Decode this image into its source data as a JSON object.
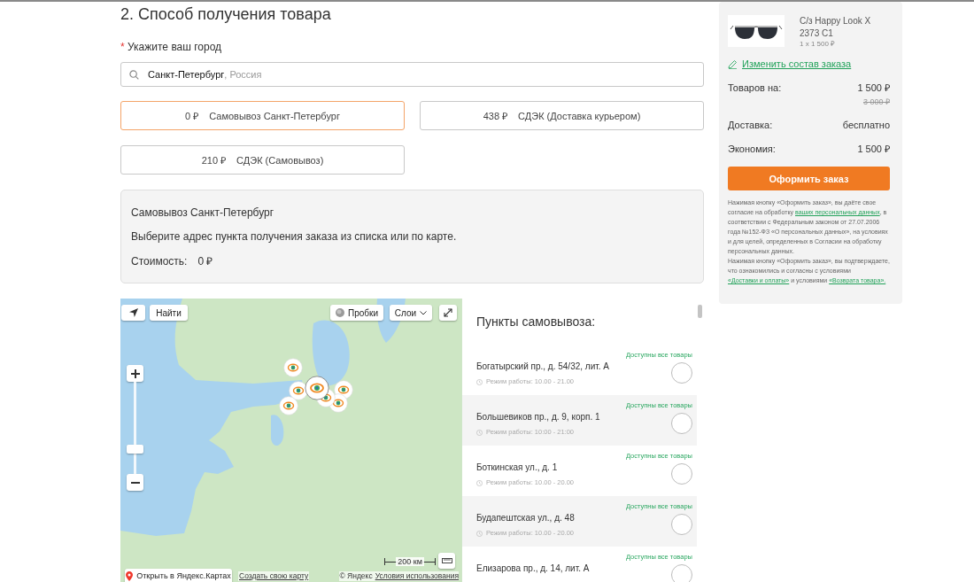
{
  "section": {
    "title": "2. Способ получения товара"
  },
  "city": {
    "required_mark": "*",
    "label": "Укажите ваш город",
    "value": "Санкт-Петербург",
    "suffix": ", Россия"
  },
  "delivery_options": [
    {
      "price": "0 ₽",
      "label": "Самовывоз Санкт-Петербург",
      "selected": true
    },
    {
      "price": "438 ₽",
      "label": "СДЭК (Доставка курьером)",
      "selected": false
    },
    {
      "price": "210 ₽",
      "label": "СДЭК (Самовывоз)",
      "selected": false
    }
  ],
  "info_panel": {
    "title": "Самовывоз Санкт-Петербург",
    "instruction": "Выберите адрес пункта получения заказа из списка или по карте.",
    "cost_label": "Стоимость:",
    "cost_value": "0 ₽"
  },
  "map": {
    "search_button": "Найти",
    "traffic_button": "Пробки",
    "layers_button": "Слои",
    "zoom": {
      "level": 0.25
    },
    "scale": "200 км",
    "open_link": "Открыть в Яндекс.Картах",
    "create_link": "Создать свою карту",
    "copyright": "© Яндекс",
    "terms_link": "Условия использования"
  },
  "pickup_points": {
    "title": "Пункты самовывоза:",
    "items": [
      {
        "availability": "Доступны все товары",
        "address": "Богатырский пр., д. 54/32, лит. А",
        "hours": "Режим работы: 10.00 - 21.00",
        "selected": false
      },
      {
        "availability": "Доступны все товары",
        "address": "Большевиков пр., д. 9, корп. 1",
        "hours": "Режим работы: 10:00 - 21:00",
        "selected": false
      },
      {
        "availability": "Доступны все товары",
        "address": "Боткинская ул., д. 1",
        "hours": "Режим работы: 10.00 - 20.00",
        "selected": false
      },
      {
        "availability": "Доступны все товары",
        "address": "Будапештская ул., д. 48",
        "hours": "Режим работы: 10.00 - 20.00",
        "selected": false
      },
      {
        "availability": "Доступны все товары",
        "address": "Елизарова пр., д. 14, лит. А",
        "selected": false
      }
    ]
  },
  "order_summary": {
    "product": {
      "name": "С/з Happy Look X 2373 C1",
      "quantity": "1 x 1 500 ₽"
    },
    "edit_link": "Изменить состав заказа",
    "rows": [
      {
        "label": "Товаров на:",
        "value": "1 500 ₽",
        "old_value": "3 000 ₽"
      },
      {
        "label": "Доставка:",
        "value": "бесплатно"
      },
      {
        "label": "Экономия:",
        "value": "1 500 ₽"
      }
    ],
    "checkout_button": "Оформить заказ",
    "legal": [
      {
        "parts": [
          {
            "kind": "text",
            "text": "Нажимая кнопку «Оформить заказ», вы даёте свое согласие на обработку "
          },
          {
            "kind": "link",
            "text": "ваших персональных данных"
          },
          {
            "kind": "text",
            "text": ", в соответствии с Федеральным законом от 27.07.2006 года №152-ФЗ «О персональных данных», на условиях и для целей, определенных в Согласии на обработку персональных данных."
          }
        ]
      },
      {
        "parts": [
          {
            "kind": "text",
            "text": "Нажимая кнопку «Оформить заказ», вы подтверждаете, что ознакомились и согласны с условиями "
          },
          {
            "kind": "link",
            "text": "«Доставки и оплаты»"
          },
          {
            "kind": "text",
            "text": " и условиями "
          },
          {
            "kind": "link",
            "text": "«Возврата товара»."
          }
        ]
      }
    ]
  }
}
